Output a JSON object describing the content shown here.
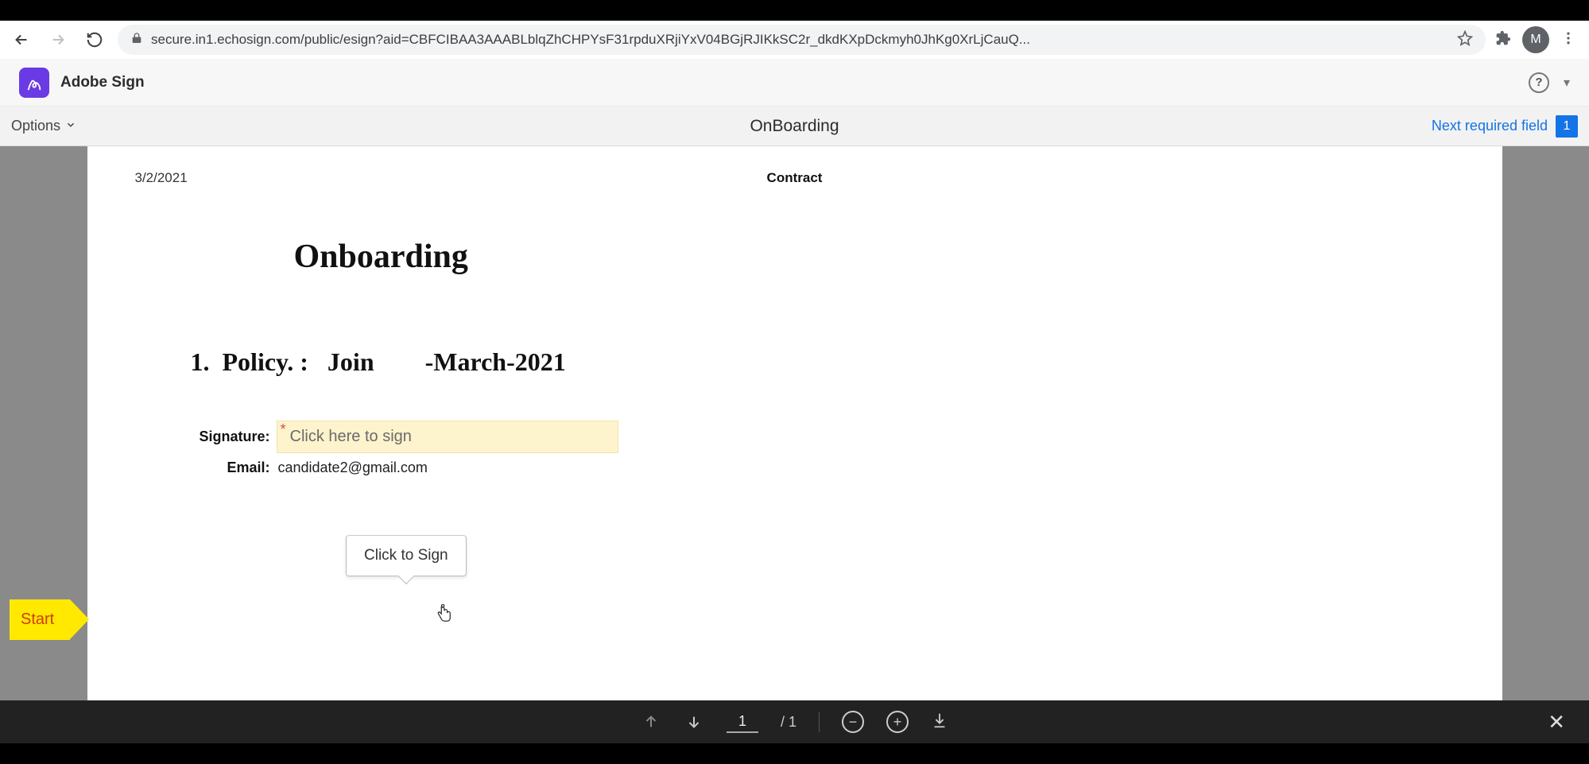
{
  "browser": {
    "url_display": "secure.in1.echosign.com/public/esign?aid=CBFCIBAA3AAABLblqZhCHPYsF31rpduXRjiYxV04BGjRJIKkSC2r_dkdKXpDckmyh0JhKg0XrLjCauQ...",
    "avatar_initial": "M"
  },
  "app": {
    "name": "Adobe Sign"
  },
  "toolbar": {
    "options_label": "Options",
    "document_name": "OnBoarding",
    "next_field_label": "Next required field",
    "required_count": "1"
  },
  "document": {
    "date": "3/2/2021",
    "header_right": "Contract",
    "title": "Onboarding",
    "policy_line": "1.  Policy. :   Join        -March-2021",
    "signature_label": "Signature:",
    "signature_placeholder": "Click here to sign",
    "email_label": "Email:",
    "email_value": "candidate2@gmail.com"
  },
  "tooltip": {
    "text": "Click to Sign"
  },
  "start_flag": "Start",
  "footer": {
    "page_current": "1",
    "page_total": "/  1"
  }
}
